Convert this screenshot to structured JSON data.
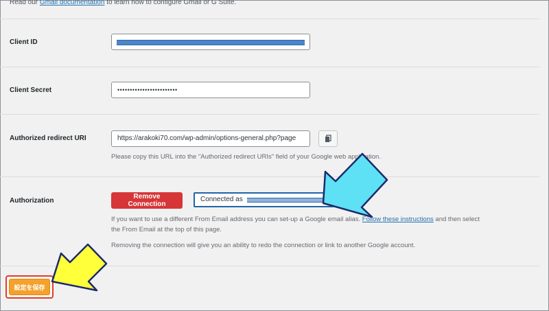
{
  "intro": {
    "prefix": "Read our ",
    "link": "Gmail documentation",
    "suffix": " to learn how to configure Gmail or G Suite."
  },
  "client_id": {
    "label": "Client ID",
    "value": ""
  },
  "client_secret": {
    "label": "Client Secret",
    "value": "••••••••••••••••••••••••"
  },
  "redirect": {
    "label": "Authorized redirect URI",
    "value": "https://arakoki70.com/wp-admin/options-general.php?page",
    "copy_icon": "copy-icon",
    "help": "Please copy this URL into the \"Authorized redirect URIs\" field of your Google web application."
  },
  "authorization": {
    "label": "Authorization",
    "remove_button": "Remove Connection",
    "connected_prefix": "Connected as",
    "help1_prefix": "If you want to use a different From Email address you can set-up a Google email alias. ",
    "help1_link": "Follow these instructions",
    "help1_suffix": " and then select",
    "help1_line2": "the From Email at the top of this page.",
    "help2": "Removing the connection will give you an ability to redo the connection or link to another Google account."
  },
  "save_button": "設定を保存",
  "colors": {
    "link": "#2271b1",
    "remove_button": "#d63638",
    "save_button": "#f5a12c",
    "callout_arrow_blue": "#5ee0f5",
    "callout_arrow_yellow": "#ffff3a"
  }
}
